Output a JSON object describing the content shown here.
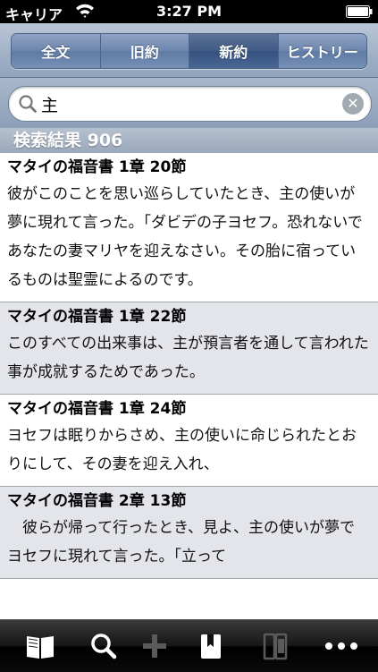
{
  "status_bar": {
    "carrier": "キャリア",
    "time": "3:27 PM"
  },
  "tabs": [
    {
      "label": "全文",
      "active": false
    },
    {
      "label": "旧約",
      "active": false
    },
    {
      "label": "新約",
      "active": true
    },
    {
      "label": "ヒストリー",
      "active": false
    }
  ],
  "search": {
    "value": "主"
  },
  "results_header": "検索結果 906",
  "results": [
    {
      "ref": "マタイの福音書 1章 20節",
      "text": "彼がこのことを思い巡らしていたとき、主の使いが夢に現れて言った。「ダビデの子ヨセフ。恐れないであなたの妻マリヤを迎えなさい。その胎に宿っているものは聖霊によるのです。"
    },
    {
      "ref": "マタイの福音書 1章 22節",
      "text": "このすべての出来事は、主が預言者を通して言われた事が成就するためであった。"
    },
    {
      "ref": "マタイの福音書 1章 24節",
      "text": "ヨセフは眠りからさめ、主の使いに命じられたとおりにして、その妻を迎え入れ、"
    },
    {
      "ref": "マタイの福音書 2章 13節",
      "text": "　彼らが帰って行ったとき、見よ、主の使いが夢でヨセフに現れて言った。「立って"
    }
  ],
  "toolbar": {
    "icons": [
      "book-icon",
      "search-icon",
      "add-icon",
      "bookmark-icon",
      "split-view-icon",
      "more-icon"
    ],
    "colors": {
      "active": "#ffffff",
      "disabled": "#5a5a5a"
    }
  }
}
